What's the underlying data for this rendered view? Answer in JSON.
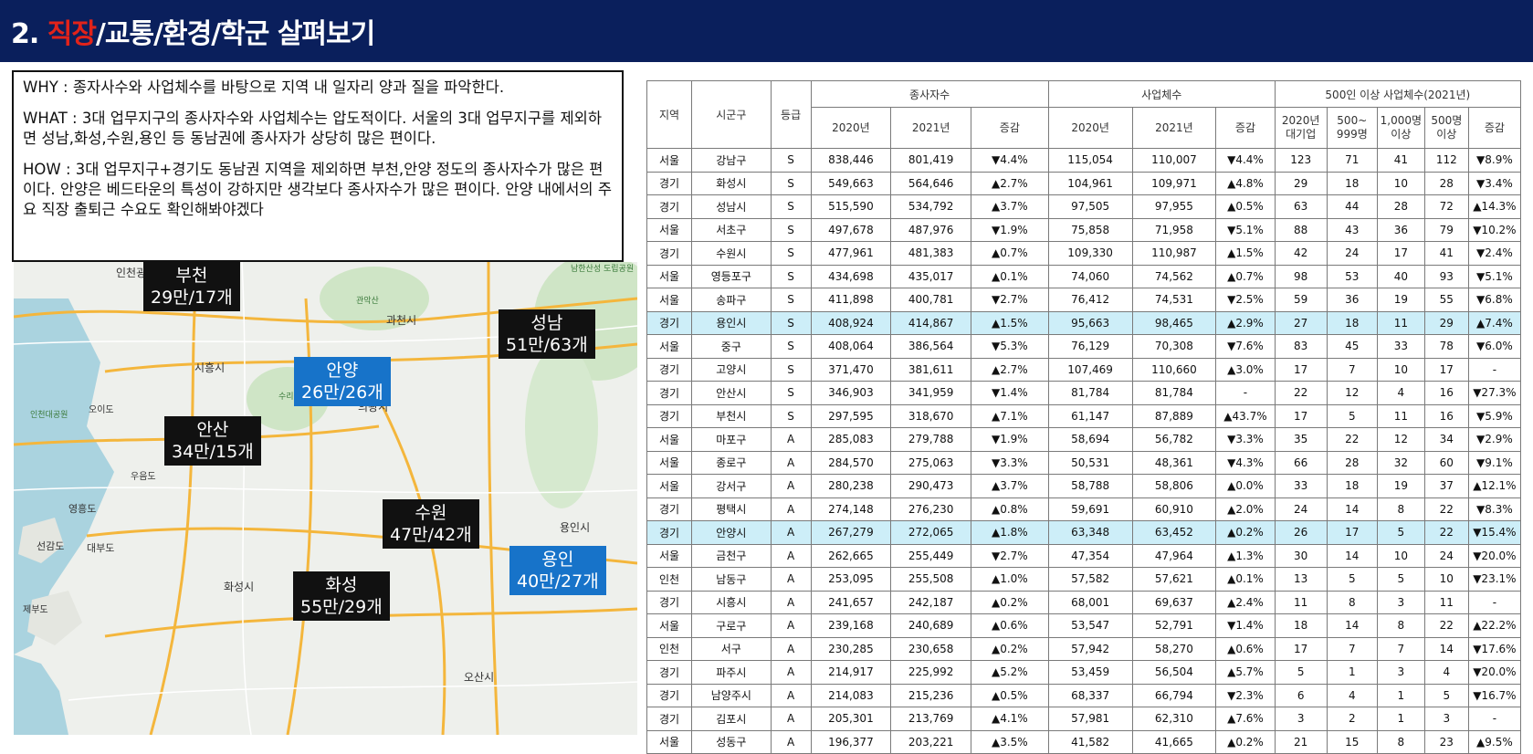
{
  "header": {
    "title_prefix": "2. ",
    "title_highlight": "직장",
    "title_rest": "/교통/환경/학군 살펴보기"
  },
  "notes": {
    "why": "WHY : 종자사수와 사업체수를 바탕으로 지역 내 일자리 양과 질을 파악한다.",
    "what": "WHAT : 3대 업무지구의 종사자수와 사업체수는 압도적이다. 서울의 3대 업무지구를 제외하면 성남,화성,수원,용인 등 동남권에 종사자가 상당히 많은 편이다.",
    "how": "HOW : 3대 업무지구+경기도 동남권 지역을 제외하면 부천,안양 정도의 종사자수가 많은 편이다. 안양은 베드타운의 특성이 강하지만 생각보다 종사자수가 많은 편이다. 안양 내에서의 주요 직장 출퇴근 수요도 확인해봐야겠다"
  },
  "map": {
    "cities": [
      "인천광",
      "과천시",
      "시흥시",
      "의왕시",
      "화성시",
      "오산시",
      "용인시",
      "관악산",
      "수리산 도립공원",
      "남한산성 도립공원",
      "영흥도",
      "대부도",
      "선감도",
      "우음도",
      "제부도",
      "오이도",
      "인천대공원"
    ],
    "tags": [
      {
        "name": "부천",
        "value": "29만/17개",
        "style": "black"
      },
      {
        "name": "안양",
        "value": "26만/26개",
        "style": "blue"
      },
      {
        "name": "성남",
        "value": "51만/63개",
        "style": "black"
      },
      {
        "name": "안산",
        "value": "34만/15개",
        "style": "black"
      },
      {
        "name": "수원",
        "value": "47만/42개",
        "style": "black"
      },
      {
        "name": "용인",
        "value": "40만/27개",
        "style": "blue"
      },
      {
        "name": "화성",
        "value": "55만/29개",
        "style": "black"
      }
    ]
  },
  "table": {
    "group_headers": [
      "지역",
      "시군구",
      "등급",
      "종사자수",
      "사업체수",
      "500인 이상 사업체수(2021년)"
    ],
    "sub_headers": [
      "2020년",
      "2021년",
      "증감",
      "2020년",
      "2021년",
      "증감",
      "2020년 대기업",
      "500~ 999명",
      "1,000명 이상",
      "500명 이상",
      "증감"
    ],
    "rows": [
      [
        "서울",
        "강남구",
        "S",
        "838,446",
        "801,419",
        "▼4.4%",
        "115,054",
        "110,007",
        "▼4.4%",
        "123",
        "71",
        "41",
        "112",
        "▼8.9%"
      ],
      [
        "경기",
        "화성시",
        "S",
        "549,663",
        "564,646",
        "▲2.7%",
        "104,961",
        "109,971",
        "▲4.8%",
        "29",
        "18",
        "10",
        "28",
        "▼3.4%"
      ],
      [
        "경기",
        "성남시",
        "S",
        "515,590",
        "534,792",
        "▲3.7%",
        "97,505",
        "97,955",
        "▲0.5%",
        "63",
        "44",
        "28",
        "72",
        "▲14.3%"
      ],
      [
        "서울",
        "서초구",
        "S",
        "497,678",
        "487,976",
        "▼1.9%",
        "75,858",
        "71,958",
        "▼5.1%",
        "88",
        "43",
        "36",
        "79",
        "▼10.2%"
      ],
      [
        "경기",
        "수원시",
        "S",
        "477,961",
        "481,383",
        "▲0.7%",
        "109,330",
        "110,987",
        "▲1.5%",
        "42",
        "24",
        "17",
        "41",
        "▼2.4%"
      ],
      [
        "서울",
        "영등포구",
        "S",
        "434,698",
        "435,017",
        "▲0.1%",
        "74,060",
        "74,562",
        "▲0.7%",
        "98",
        "53",
        "40",
        "93",
        "▼5.1%"
      ],
      [
        "서울",
        "송파구",
        "S",
        "411,898",
        "400,781",
        "▼2.7%",
        "76,412",
        "74,531",
        "▼2.5%",
        "59",
        "36",
        "19",
        "55",
        "▼6.8%"
      ],
      [
        "경기",
        "용인시",
        "S",
        "408,924",
        "414,867",
        "▲1.5%",
        "95,663",
        "98,465",
        "▲2.9%",
        "27",
        "18",
        "11",
        "29",
        "▲7.4%"
      ],
      [
        "서울",
        "중구",
        "S",
        "408,064",
        "386,564",
        "▼5.3%",
        "76,129",
        "70,308",
        "▼7.6%",
        "83",
        "45",
        "33",
        "78",
        "▼6.0%"
      ],
      [
        "경기",
        "고양시",
        "S",
        "371,470",
        "381,611",
        "▲2.7%",
        "107,469",
        "110,660",
        "▲3.0%",
        "17",
        "7",
        "10",
        "17",
        "-"
      ],
      [
        "경기",
        "안산시",
        "S",
        "346,903",
        "341,959",
        "▼1.4%",
        "81,784",
        "81,784",
        "-",
        "22",
        "12",
        "4",
        "16",
        "▼27.3%"
      ],
      [
        "경기",
        "부천시",
        "S",
        "297,595",
        "318,670",
        "▲7.1%",
        "61,147",
        "87,889",
        "▲43.7%",
        "17",
        "5",
        "11",
        "16",
        "▼5.9%"
      ],
      [
        "서울",
        "마포구",
        "A",
        "285,083",
        "279,788",
        "▼1.9%",
        "58,694",
        "56,782",
        "▼3.3%",
        "35",
        "22",
        "12",
        "34",
        "▼2.9%"
      ],
      [
        "서울",
        "종로구",
        "A",
        "284,570",
        "275,063",
        "▼3.3%",
        "50,531",
        "48,361",
        "▼4.3%",
        "66",
        "28",
        "32",
        "60",
        "▼9.1%"
      ],
      [
        "서울",
        "강서구",
        "A",
        "280,238",
        "290,473",
        "▲3.7%",
        "58,788",
        "58,806",
        "▲0.0%",
        "33",
        "18",
        "19",
        "37",
        "▲12.1%"
      ],
      [
        "경기",
        "평택시",
        "A",
        "274,148",
        "276,230",
        "▲0.8%",
        "59,691",
        "60,910",
        "▲2.0%",
        "24",
        "14",
        "8",
        "22",
        "▼8.3%"
      ],
      [
        "경기",
        "안양시",
        "A",
        "267,279",
        "272,065",
        "▲1.8%",
        "63,348",
        "63,452",
        "▲0.2%",
        "26",
        "17",
        "5",
        "22",
        "▼15.4%"
      ],
      [
        "서울",
        "금천구",
        "A",
        "262,665",
        "255,449",
        "▼2.7%",
        "47,354",
        "47,964",
        "▲1.3%",
        "30",
        "14",
        "10",
        "24",
        "▼20.0%"
      ],
      [
        "인천",
        "남동구",
        "A",
        "253,095",
        "255,508",
        "▲1.0%",
        "57,582",
        "57,621",
        "▲0.1%",
        "13",
        "5",
        "5",
        "10",
        "▼23.1%"
      ],
      [
        "경기",
        "시흥시",
        "A",
        "241,657",
        "242,187",
        "▲0.2%",
        "68,001",
        "69,637",
        "▲2.4%",
        "11",
        "8",
        "3",
        "11",
        "-"
      ],
      [
        "서울",
        "구로구",
        "A",
        "239,168",
        "240,689",
        "▲0.6%",
        "53,547",
        "52,791",
        "▼1.4%",
        "18",
        "14",
        "8",
        "22",
        "▲22.2%"
      ],
      [
        "인천",
        "서구",
        "A",
        "230,285",
        "230,658",
        "▲0.2%",
        "57,942",
        "58,270",
        "▲0.6%",
        "17",
        "7",
        "7",
        "14",
        "▼17.6%"
      ],
      [
        "경기",
        "파주시",
        "A",
        "214,917",
        "225,992",
        "▲5.2%",
        "53,459",
        "56,504",
        "▲5.7%",
        "5",
        "1",
        "3",
        "4",
        "▼20.0%"
      ],
      [
        "경기",
        "남양주시",
        "A",
        "214,083",
        "215,236",
        "▲0.5%",
        "68,337",
        "66,794",
        "▼2.3%",
        "6",
        "4",
        "1",
        "5",
        "▼16.7%"
      ],
      [
        "경기",
        "김포시",
        "A",
        "205,301",
        "213,769",
        "▲4.1%",
        "57,981",
        "62,310",
        "▲7.6%",
        "3",
        "2",
        "1",
        "3",
        "-"
      ],
      [
        "서울",
        "성동구",
        "A",
        "196,377",
        "203,221",
        "▲3.5%",
        "41,582",
        "41,665",
        "▲0.2%",
        "21",
        "15",
        "8",
        "23",
        "▲9.5%"
      ]
    ],
    "highlighted_rows": [
      "용인시",
      "안양시"
    ]
  }
}
